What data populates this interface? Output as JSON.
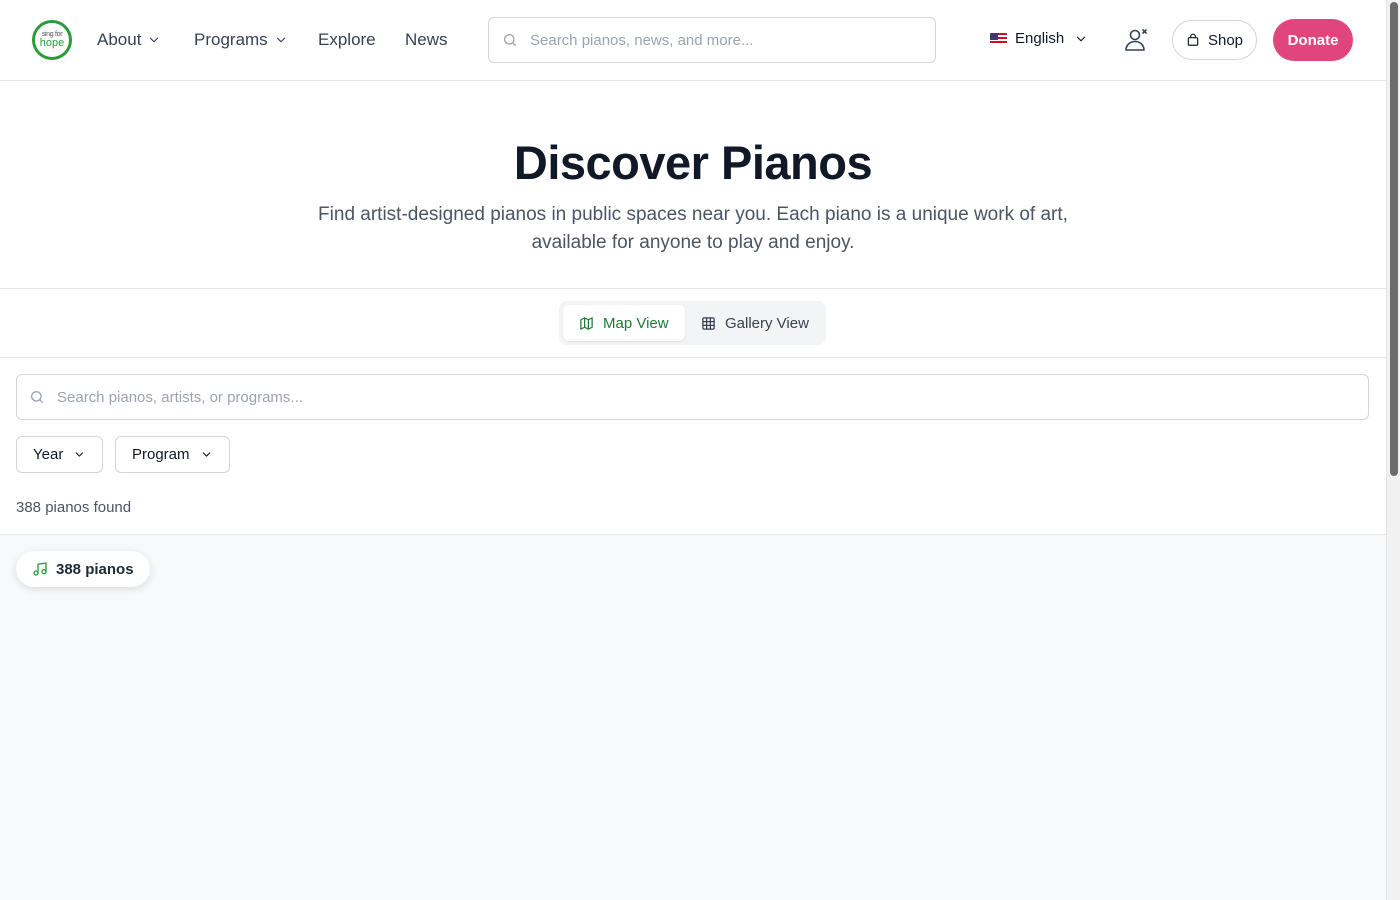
{
  "header": {
    "logo": {
      "line1": "sing for",
      "line2": "hope"
    },
    "nav": [
      {
        "label": "About",
        "has_dropdown": true
      },
      {
        "label": "Programs",
        "has_dropdown": true
      },
      {
        "label": "Explore",
        "has_dropdown": false
      },
      {
        "label": "News",
        "has_dropdown": false
      }
    ],
    "search": {
      "placeholder": "Search pianos, news, and more..."
    },
    "language": {
      "label": "English",
      "flag": "us-flag-icon"
    },
    "account_icon": "user-account-icon",
    "shop_label": "Shop",
    "donate_label": "Donate"
  },
  "hero": {
    "title": "Discover Pianos",
    "subtitle": "Find artist-designed pianos in public spaces near you. Each piano is a unique work of art, available for anyone to play and enjoy."
  },
  "view_toggle": {
    "map_label": "Map View",
    "gallery_label": "Gallery View",
    "active": "map"
  },
  "filters": {
    "search": {
      "placeholder": "Search pianos, artists, or programs..."
    },
    "year_label": "Year",
    "program_label": "Program",
    "results_text": "388 pianos found"
  },
  "map": {
    "count_pill": "388 pianos"
  },
  "colors": {
    "brand_green": "#2e9b3a",
    "active_green": "#1f7a34",
    "donate_pink": "#e0457b",
    "map_bg": "#f8f9fa"
  }
}
